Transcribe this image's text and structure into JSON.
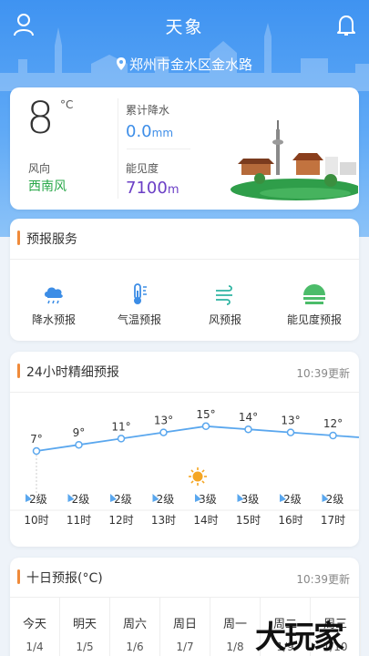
{
  "header": {
    "title": "天象",
    "location": "郑州市金水区金水路"
  },
  "current": {
    "temperature": "8",
    "temp_unit": "°C",
    "precip_label": "累计降水",
    "precip_value": "0.0",
    "precip_unit": "mm",
    "wind_label": "风向",
    "wind_value": "西南风",
    "visibility_label": "能见度",
    "visibility_value": "7100",
    "visibility_unit": "m"
  },
  "services": {
    "title": "预报服务",
    "items": [
      {
        "label": "降水预报",
        "icon": "rain-cloud-icon"
      },
      {
        "label": "气温预报",
        "icon": "thermometer-icon"
      },
      {
        "label": "风预报",
        "icon": "wind-icon"
      },
      {
        "label": "能见度预报",
        "icon": "visibility-icon"
      }
    ]
  },
  "hourly": {
    "title": "24小时精细预报",
    "updated": "10:39更新",
    "current_hour_icon": "sun-icon",
    "hours": [
      {
        "time": "10时",
        "temp": 7,
        "temp_label": "7°",
        "wind": "2级"
      },
      {
        "time": "11时",
        "temp": 9,
        "temp_label": "9°",
        "wind": "2级"
      },
      {
        "time": "12时",
        "temp": 11,
        "temp_label": "11°",
        "wind": "2级"
      },
      {
        "time": "13时",
        "temp": 13,
        "temp_label": "13°",
        "wind": "2级"
      },
      {
        "time": "14时",
        "temp": 15,
        "temp_label": "15°",
        "wind": "3级"
      },
      {
        "time": "15时",
        "temp": 14,
        "temp_label": "14°",
        "wind": "3级"
      },
      {
        "time": "16时",
        "temp": 13,
        "temp_label": "13°",
        "wind": "2级"
      },
      {
        "time": "17时",
        "temp": 12,
        "temp_label": "12°",
        "wind": "2级"
      }
    ]
  },
  "daily": {
    "title": "十日预报(°C)",
    "updated": "10:39更新",
    "days": [
      {
        "name": "今天",
        "date": "1/4"
      },
      {
        "name": "明天",
        "date": "1/5"
      },
      {
        "name": "周六",
        "date": "1/6"
      },
      {
        "name": "周日",
        "date": "1/7"
      },
      {
        "name": "周一",
        "date": "1/8"
      },
      {
        "name": "周二",
        "date": "1/9"
      },
      {
        "name": "周三",
        "date": "1/10"
      }
    ]
  },
  "watermark": "大玩家"
}
